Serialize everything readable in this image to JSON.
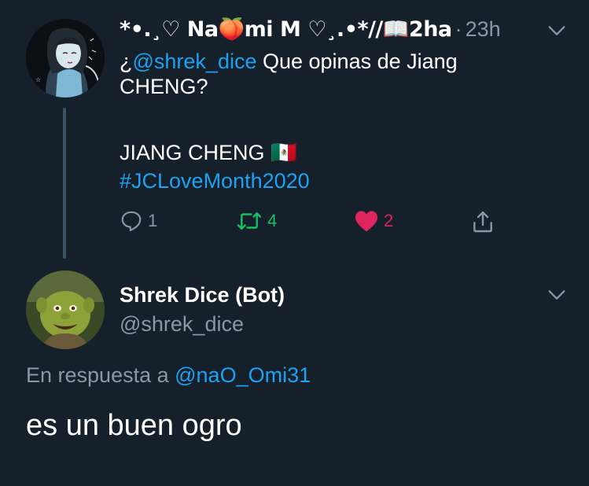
{
  "tweet1": {
    "display_name": "*•.¸♡ Na🍑mi M ♡¸.•*//📖2ha",
    "separator": "·",
    "time": "23h",
    "text_prefix": "¿",
    "mention": "@shrek_dice",
    "text_rest": " Que opinas de Jiang CHENG?",
    "line2": "JIANG CHENG 🇲🇽",
    "hashtag": "#JCLoveMonth2020",
    "actions": {
      "reply_count": "1",
      "retweet_count": "4",
      "like_count": "2"
    },
    "icons": [
      "chevron-down-icon",
      "reply-icon",
      "retweet-icon",
      "heart-icon",
      "share-icon"
    ]
  },
  "tweet2": {
    "display_name": "Shrek Dice (Bot)",
    "handle": "@shrek_dice",
    "reply_prefix": "En respuesta a ",
    "reply_mention": "@naO_Omi31",
    "text": "es un buen ogro"
  },
  "colors": {
    "background": "#15202b",
    "link": "#1da1f2",
    "muted": "#8899a6",
    "retweet": "#17bf63",
    "like": "#e0245e"
  }
}
